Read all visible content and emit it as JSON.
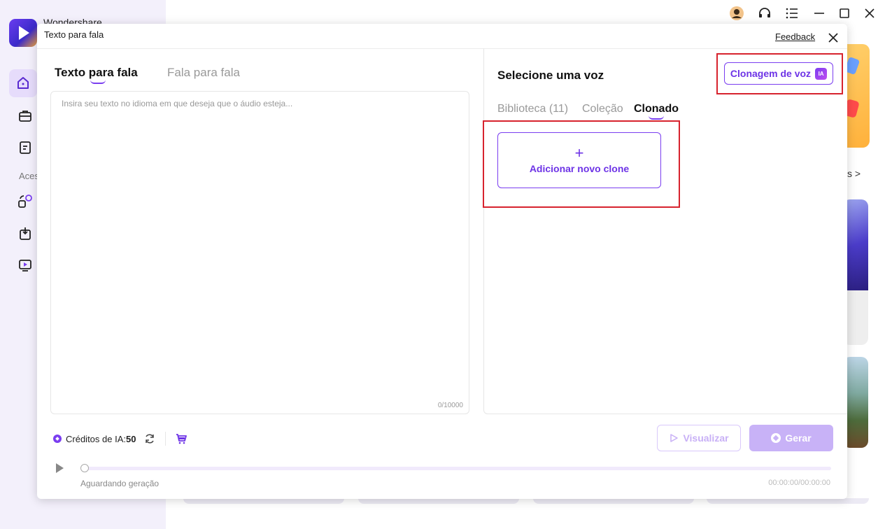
{
  "app": {
    "name": "Wondershare",
    "sidebar_section_label": "Aces"
  },
  "background": {
    "more_label": "s >"
  },
  "dialog": {
    "title": "Texto para fala",
    "feedback_label": "Feedback",
    "left_tabs": [
      {
        "label": "Texto para fala",
        "active": true
      },
      {
        "label": "Fala para fala",
        "active": false
      }
    ],
    "text_input": {
      "placeholder": "Insira seu texto no idioma em que deseja que o áudio esteja...",
      "value": "",
      "char_count": "0/10000"
    },
    "voice_panel": {
      "heading": "Selecione uma voz",
      "clone_button_label": "Clonagem de voz",
      "clone_badge": "IA",
      "tabs": [
        {
          "label": "Biblioteca (11)",
          "active": false
        },
        {
          "label": "Coleção",
          "active": false
        },
        {
          "label": "Clonado",
          "active": true
        }
      ],
      "add_clone_icon": "+",
      "add_clone_label": "Adicionar novo clone"
    },
    "credits": {
      "label": "Créditos de IA:",
      "value": "50"
    },
    "buttons": {
      "preview_label": "Visualizar",
      "generate_label": "Gerar"
    },
    "player": {
      "status": "Aguardando geração",
      "time": "00:00:00/00:00:00",
      "progress": 0
    }
  },
  "colors": {
    "accent": "#7a3df0",
    "highlight_box": "#d7232e",
    "sidebar_bg": "#f3f0fb"
  }
}
